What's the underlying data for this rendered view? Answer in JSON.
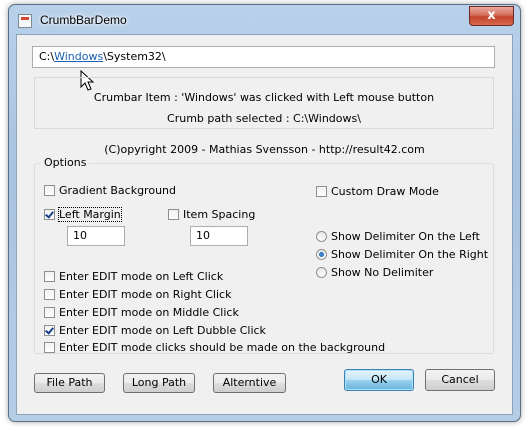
{
  "window": {
    "title": "CrumbBarDemo",
    "close_glyph": "x"
  },
  "crumbbar": {
    "prefix": "C:\\",
    "link": "Windows",
    "suffix": "\\System32\\"
  },
  "info": {
    "clicked_message": "Crumbar Item : 'Windows' was clicked with Left mouse button",
    "path_message": "Crumb path selected : C:\\Windows\\"
  },
  "copyright": "(C)opyright 2009 - Mathias Svensson - http://result42.com",
  "options": {
    "legend": "Options",
    "gradient_background": {
      "label": "Gradient Background",
      "checked": false
    },
    "custom_draw_mode": {
      "label": "Custom Draw Mode",
      "checked": false
    },
    "left_margin": {
      "label": "Left Margin",
      "checked": true,
      "value": "10"
    },
    "item_spacing": {
      "label": "Item Spacing",
      "checked": false,
      "value": "10"
    },
    "delimiter": {
      "options": [
        "Show Delimiter On the Left",
        "Show Delimiter On the Right",
        "Show No Delimiter"
      ],
      "selected": "Show Delimiter On the Right"
    },
    "edit_modes": [
      {
        "label": "Enter EDIT mode on Left Click",
        "checked": false
      },
      {
        "label": "Enter EDIT mode on Right Click",
        "checked": false
      },
      {
        "label": "Enter EDIT mode on Middle Click",
        "checked": false
      },
      {
        "label": "Enter EDIT mode on Left Dubble Click",
        "checked": true
      },
      {
        "label": "Enter EDIT mode clicks should be made on the background",
        "checked": false
      }
    ]
  },
  "buttons": {
    "file_path": "File Path",
    "long_path": "Long Path",
    "alternative": "Alterntive",
    "ok": "OK",
    "cancel": "Cancel"
  },
  "icons": [
    "app-icon",
    "close-icon",
    "mouse-cursor-icon"
  ]
}
